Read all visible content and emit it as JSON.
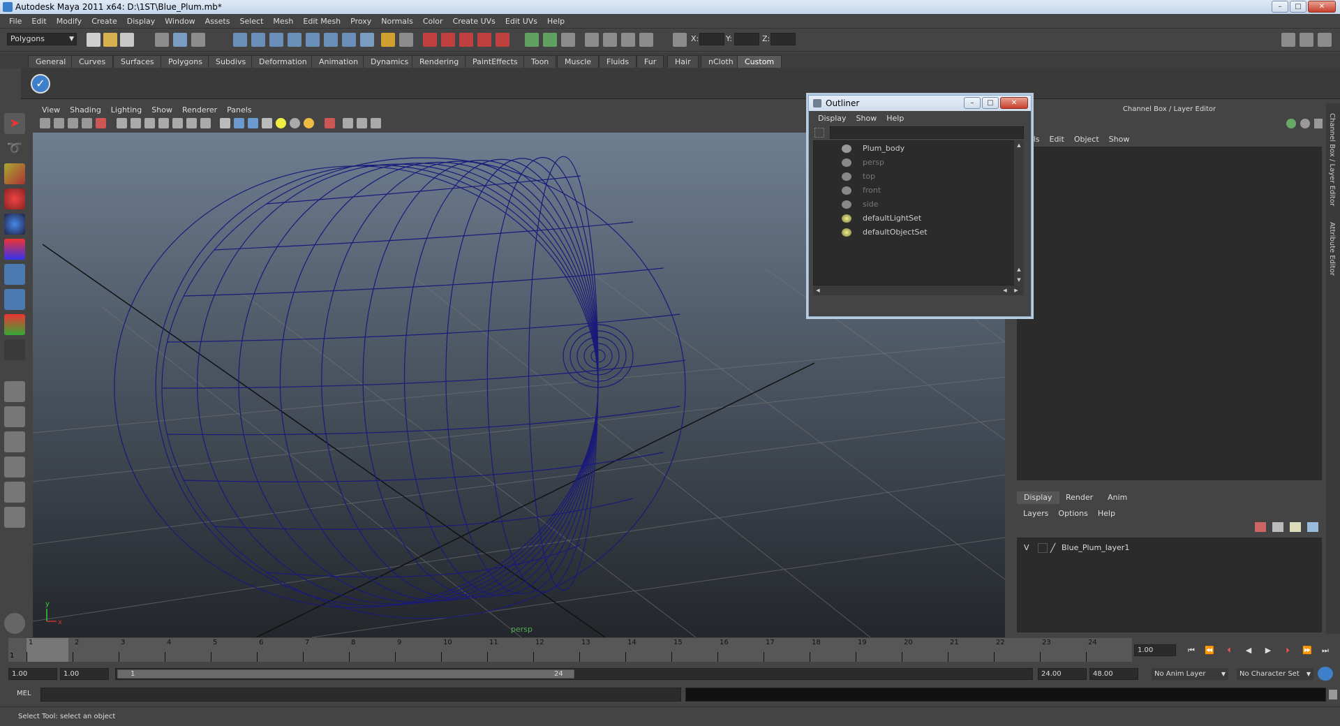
{
  "title": "Autodesk Maya 2011 x64: D:\\1ST\\Blue_Plum.mb*",
  "window_buttons": {
    "minimize": "–",
    "maximize": "□",
    "close": "✕"
  },
  "menubar": [
    "File",
    "Edit",
    "Modify",
    "Create",
    "Display",
    "Window",
    "Assets",
    "Select",
    "Mesh",
    "Edit Mesh",
    "Proxy",
    "Normals",
    "Color",
    "Create UVs",
    "Edit UVs",
    "Help"
  ],
  "statusline": {
    "mode": "Polygons",
    "x_label": "X:",
    "y_label": "Y:",
    "z_label": "Z:"
  },
  "shelf_tabs": [
    "General",
    "Curves",
    "Surfaces",
    "Polygons",
    "Subdivs",
    "Deformation",
    "Animation",
    "Dynamics",
    "Rendering",
    "PaintEffects",
    "Toon",
    "Muscle",
    "Fluids",
    "Fur",
    "Hair",
    "nCloth",
    "Custom"
  ],
  "shelf_active": "Custom",
  "viewport": {
    "menu": [
      "View",
      "Shading",
      "Lighting",
      "Show",
      "Renderer",
      "Panels"
    ],
    "camera_label": "persp",
    "axis_y": "y",
    "axis_x": "x",
    "wire_color": "#1a1a7a"
  },
  "outliner": {
    "title": "Outliner",
    "menu": [
      "Display",
      "Show",
      "Help"
    ],
    "items": [
      {
        "label": "Plum_body",
        "dim": false
      },
      {
        "label": "persp",
        "dim": true
      },
      {
        "label": "top",
        "dim": true
      },
      {
        "label": "front",
        "dim": true
      },
      {
        "label": "side",
        "dim": true
      },
      {
        "label": "defaultLightSet",
        "dim": false
      },
      {
        "label": "defaultObjectSet",
        "dim": false
      }
    ]
  },
  "channel_box": {
    "title": "Channel Box / Layer Editor",
    "menu": [
      "nnels",
      "Edit",
      "Object",
      "Show"
    ]
  },
  "side_tabs": [
    "Channel Box / Layer Editor",
    "Attribute Editor"
  ],
  "layer_editor": {
    "tabs": [
      "Display",
      "Render",
      "Anim"
    ],
    "menu": [
      "Layers",
      "Options",
      "Help"
    ],
    "layer": {
      "visibility": "V",
      "name": "Blue_Plum_layer1"
    }
  },
  "time_slider": {
    "ticks": [
      "1",
      "2",
      "3",
      "4",
      "5",
      "6",
      "7",
      "8",
      "9",
      "10",
      "11",
      "12",
      "13",
      "14",
      "15",
      "16",
      "17",
      "18",
      "19",
      "20",
      "21",
      "22",
      "23",
      "24"
    ],
    "current_frame": "1",
    "current_time": "1.00"
  },
  "range": {
    "start": "1.00",
    "playback_start": "1.00",
    "thumb_start": "1",
    "thumb_end": "24",
    "playback_end": "24.00",
    "end": "48.00",
    "anim_layer": "No Anim Layer",
    "character_set": "No Character Set"
  },
  "command_line": {
    "label": "MEL"
  },
  "help_line": "Select Tool: select an object"
}
